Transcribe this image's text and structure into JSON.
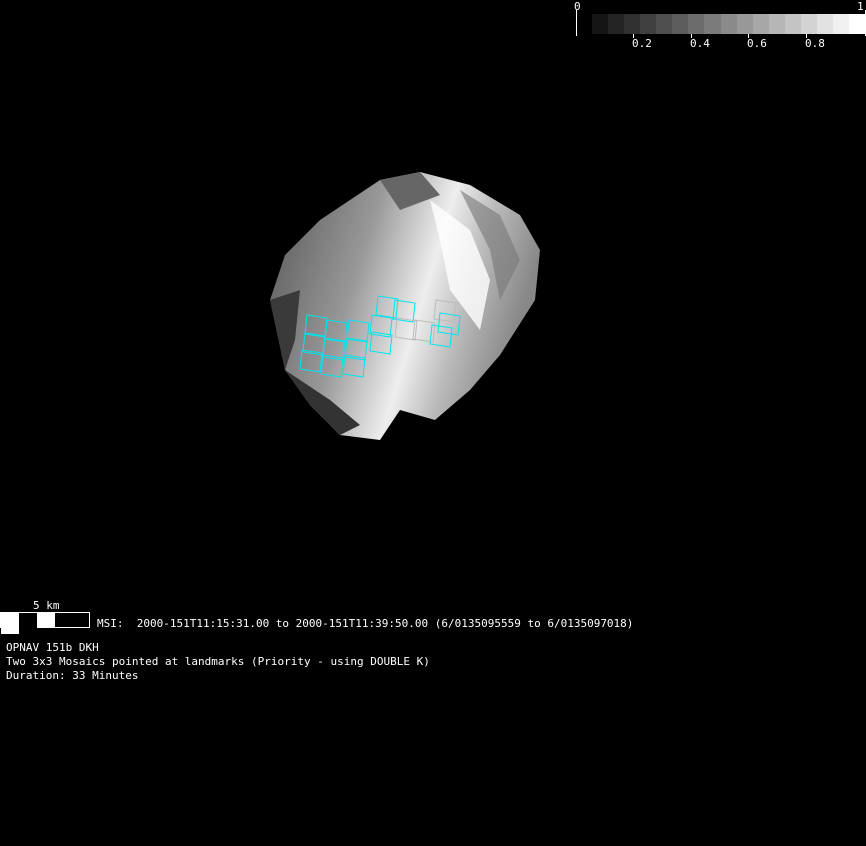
{
  "colorbar": {
    "min_label": "0",
    "max_label": "1",
    "tick_labels": [
      "0.2",
      "0.4",
      "0.6",
      "0.8"
    ],
    "segments": 17
  },
  "scale_bar": {
    "label": "5 km"
  },
  "msi_line": "MSI:  2000-151T11:15:31.00 to 2000-151T11:39:50.00 (6/0135095559 to 6/0135097018)",
  "info": [
    "OPNAV 151b DKH",
    "Two 3x3 Mosaics pointed at landmarks (Priority - using DOUBLE K)",
    "Duration: 33 Minutes"
  ],
  "colors": {
    "footprint": "#00e5ee",
    "footprint_secondary": "#bbbbbb",
    "background": "#000000"
  }
}
